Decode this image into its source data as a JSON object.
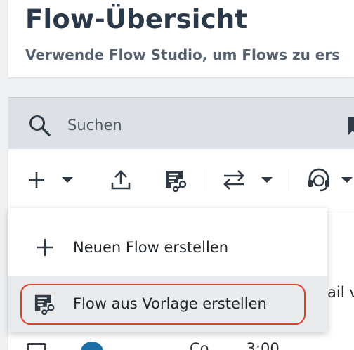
{
  "header": {
    "title": "Flow-Übersicht",
    "subtitle": "Verwende Flow Studio, um Flows zu ers"
  },
  "search": {
    "placeholder": "Suchen",
    "value": ""
  },
  "toolbar": {
    "items": [
      {
        "icon": "plus-icon",
        "has_dropdown": true
      },
      {
        "icon": "upload-icon",
        "has_dropdown": false
      },
      {
        "icon": "flow-template-icon",
        "has_dropdown": false
      },
      {
        "icon": "swap-arrows-icon",
        "has_dropdown": true
      },
      {
        "icon": "headset-icon",
        "has_dropdown": true
      }
    ]
  },
  "dropdown_menu": {
    "items": [
      {
        "icon": "plus-icon",
        "label": "Neuen Flow erstellen"
      },
      {
        "icon": "flow-template-icon",
        "label": "Flow aus Vorlage erstellen",
        "highlighted": true
      }
    ]
  },
  "background_list": {
    "partial_text": "ail v",
    "row_text": "Co... ... 3:00"
  },
  "colors": {
    "accent_ring": "#d9412c",
    "text_dark": "#2b3a4a",
    "search_bg": "#dde1e5",
    "page_bg": "#eef0f2"
  }
}
